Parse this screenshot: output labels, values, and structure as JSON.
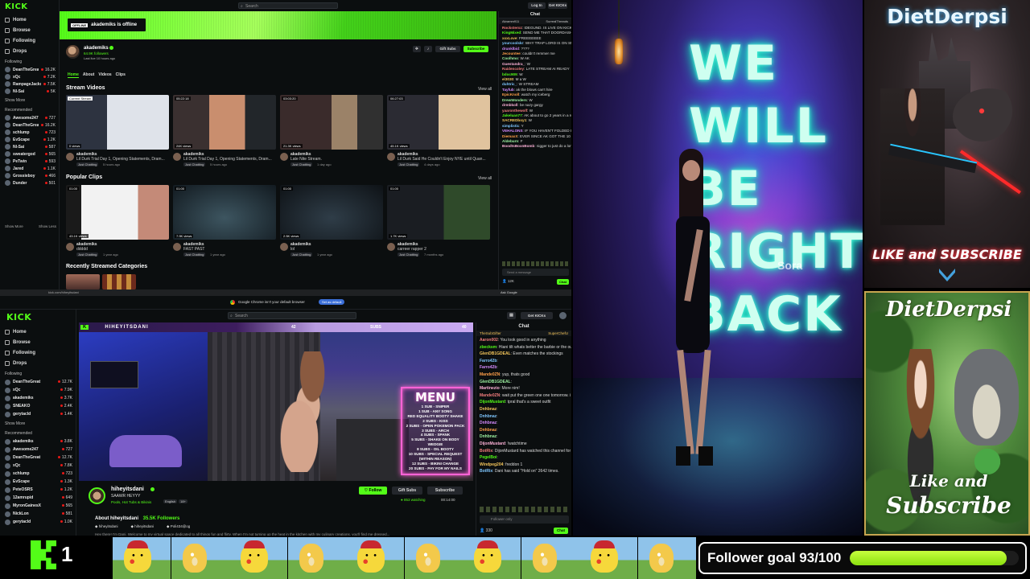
{
  "top": {
    "logo": "KICK",
    "search_placeholder": "Search",
    "login_label": "Log In",
    "signup_label": "Get KICKs",
    "nav": [
      "Home",
      "Browse",
      "Following",
      "Drops"
    ],
    "following_header": "Following",
    "show_more": "Show More",
    "show_less": "Show Less",
    "recommended_header": "Recommended",
    "following": [
      {
        "name": "DeanTheGreat",
        "sub": "IRL",
        "viewers": "16.2K"
      },
      {
        "name": "xQc",
        "sub": "Jackbox Party Packs",
        "viewers": "7.2K"
      },
      {
        "name": "RampageJackson",
        "sub": "PUBG: Battlegrounds",
        "viewers": "7.5K"
      },
      {
        "name": "Nl-Sai",
        "sub": "Just Chatting",
        "viewers": "5K"
      }
    ],
    "recommended": [
      {
        "name": "Awesome247",
        "sub": "World of Warcraft",
        "viewers": "727"
      },
      {
        "name": "DeanTheGreat",
        "sub": "IRL",
        "viewers": "16.2K"
      },
      {
        "name": "schlump",
        "sub": "Slots & Casino",
        "viewers": "723"
      },
      {
        "name": "EvScape",
        "sub": "Old School RuneScape",
        "viewers": "1.2K"
      },
      {
        "name": "Nl-Sai",
        "sub": "Just Chatting",
        "viewers": "587"
      },
      {
        "name": "sweatergod",
        "sub": "Just Chatting",
        "viewers": "565"
      },
      {
        "name": "PeTwin",
        "sub": "Slots & Casino",
        "viewers": "593"
      },
      {
        "name": "Jared",
        "sub": "Slots & Casino",
        "viewers": "1.1K"
      },
      {
        "name": "Grossieboy",
        "sub": "Slots & Casino",
        "viewers": "466"
      },
      {
        "name": "Dunder",
        "sub": "Old School RuneScape",
        "viewers": "501"
      }
    ],
    "banner_tag": "OFFLINE",
    "banner_text": "akademiks is offline",
    "channel_name": "akademiks",
    "followers": "64.9K followers",
    "last_live": "Last live 10 hours ago",
    "gift_subs": "Gift Subs",
    "subscribe": "Subscribe",
    "tabs": [
      "Home",
      "About",
      "Videos",
      "Clips"
    ],
    "stream_videos_title": "Stream Videos",
    "popular_clips_title": "Popular Clips",
    "categories_title": "Recently Streamed Categories",
    "view_all": "View all",
    "videos": [
      {
        "badge": "Current Stream",
        "duration": "",
        "views": "0 views",
        "title": "Lil Durk Trial Day 1, Opening Statements, Dram...",
        "meta": "5 hours ago",
        "tag": "Just Chatting"
      },
      {
        "badge": "",
        "duration": "05:22:18",
        "views": "24K views",
        "title": "Lil Durk Trial Day 1, Opening Statements, Dram...",
        "meta": "5 hours ago",
        "tag": "Just Chatting"
      },
      {
        "badge": "",
        "duration": "03:03:20",
        "views": "21.3K views",
        "title": "Late Nite Stream.",
        "meta": "1 day ago",
        "tag": "Just Chatting"
      },
      {
        "badge": "",
        "duration": "06:27:03",
        "views": "45.1K views",
        "title": "Lil Durk Said He Couldn't Enjoy NYE until Quan...",
        "meta": "4 days ago",
        "tag": "Just Chatting"
      }
    ],
    "clips": [
      {
        "duration": "01:00",
        "views": "43.1K views",
        "title": "ddddd",
        "meta": "1 year ago",
        "tag": "Just Chatting"
      },
      {
        "duration": "01:00",
        "views": "7.9K views",
        "title": "FAST PAST",
        "meta": "1 year ago",
        "tag": "Just Chatting"
      },
      {
        "duration": "01:00",
        "views": "2.5K views",
        "title": "lol",
        "meta": "1 year ago",
        "tag": "Just Chatting"
      },
      {
        "duration": "01:00",
        "views": "1.7K views",
        "title": "carreer rapper 2",
        "meta": "7 months ago",
        "tag": "Just Chatting"
      }
    ],
    "chat_title": "Chat",
    "chat_banner_1": "Akramm911",
    "chat_banner_2": "SurrealThreads",
    "chat": [
      "Rocksteroz: IDEGUND. IS LIVE ON KICK TKP!!",
      "KingMixed: SEND ME THAT DOORDASH ACCOUNT",
      "xxxLove: FREEEEEEE",
      "yourcoolskr: WHY TRAP LORD IS ON SMURFS??",
      "drunklbid: ????",
      "Jecountee: couldn't remmer me",
      "Coolhmo: W AK",
      "Guestandra_: W",
      "Raidencoley: LATE STREAM AI READY",
      "bdoc909: W",
      "el3030: M a W",
      "duhtric_: W STREAM",
      "Tayfub: ak the blows can't hire",
      "EpicKnoll: watch my iceberg",
      "DrewWonders: W",
      "drmbkoll: be nazy gargy",
      "yaaronthewolf: W",
      "Jakeluan77: AK about to go 2 years in a row of a few rounds",
      "SACREDboy1: W",
      "simplistic: Y",
      "VEHALONS: IF YOU HAVEN'T FOLDED IT OUT YET - HE'S A LIBERAL SHILL",
      "DiemaxX: EVER SINCE AK GOT THE 10 MONTHLY ALLOWANCE HE'S BEEN A JOY",
      "Aldeburn: F",
      "BoodtsBoxnBomb: nigger to just do a long ass stream ahahaha"
    ],
    "chat_input_placeholder": "Send a message",
    "chat_send": "Chat",
    "chat_counter": "12K"
  },
  "bottom": {
    "logo": "KICK",
    "url": "kick.com/hiheyitsdani",
    "chrome_notice": "Google Chrome isn't your default browser",
    "chrome_button": "Set as default",
    "ask_google": "Ask Google",
    "search_placeholder": "Search",
    "signup_label": "Get KICKs",
    "nav": [
      "Home",
      "Browse",
      "Following",
      "Drops"
    ],
    "following_header": "Following",
    "show_more": "Show More",
    "recommended_header": "Recommended",
    "following": [
      {
        "name": "DeanTheGreat",
        "sub": "IRL",
        "viewers": "12.7K"
      },
      {
        "name": "xQc",
        "sub": "Jackbox Party Packs",
        "viewers": "7.9K"
      },
      {
        "name": "akademiks",
        "sub": "Just Chatting",
        "viewers": "3.7K"
      },
      {
        "name": "SNEAKO",
        "sub": "Slots & Casino",
        "viewers": "2.4K"
      },
      {
        "name": "gerytacld",
        "sub": "IRL",
        "viewers": "1.4K"
      }
    ],
    "recommended": [
      {
        "name": "akademiks",
        "sub": "Just Chatting",
        "viewers": "3.8K"
      },
      {
        "name": "Awesome247",
        "sub": "World of Warcraft",
        "viewers": "727"
      },
      {
        "name": "DeanTheGreat",
        "sub": "IRL",
        "viewers": "12.7K"
      },
      {
        "name": "xQc",
        "sub": "Jackbox Party Packs",
        "viewers": "7.8K"
      },
      {
        "name": "schlump",
        "sub": "Slots & Casino",
        "viewers": "723"
      },
      {
        "name": "EvScape",
        "sub": "Old School RuneScape",
        "viewers": "1.3K"
      },
      {
        "name": "PeteOSRS",
        "sub": "Old School RuneScape",
        "viewers": "1.2K"
      },
      {
        "name": "12amrupid",
        "sub": "Just Chatting",
        "viewers": "649"
      },
      {
        "name": "MyronGainesX",
        "sub": "Just Chatting",
        "viewers": "565"
      },
      {
        "name": "NickLon",
        "sub": "Just Chatting",
        "viewers": "581"
      },
      {
        "name": "gerytacld",
        "sub": "IRL",
        "viewers": "1.0K"
      }
    ],
    "overlay_handle": "HIHEYITSDANI",
    "overlay_count_left": "42",
    "overlay_subs": "SUBS",
    "overlay_count_right": "40",
    "menu_title": "MENU",
    "menu_items": [
      "1 SUB - SNIPER",
      "1 SUB - ANY SONG",
      "RED EQUALITY BOOTY SHAKE",
      "2 SUBS - KISS",
      "2 SUBS - OPEN POKEMON PACK",
      "3 SUBS - ARCH",
      "4 SUBS - SPANK",
      "5 SUBS - SHAKE ON BODY",
      "WEDGIE",
      "8 SUBS - OIL BOOTY",
      "10 SUBS - SPECIAL REQUEST",
      "(WITHIN REASON)",
      "12 SUBS - BIKINI CHANGE",
      "20 SUBS - PAY FOR MY NAILS"
    ],
    "streamer": "hiheyitsdani",
    "stream_title": "SAAWR HEYYY",
    "categories": "Pools, Hot Tubs & Bikinis",
    "lang": "English",
    "age": "18+",
    "follow": "Follow",
    "gift_subs": "Gift Subs",
    "subscribe": "Subscribe",
    "watching": "853 watching",
    "uptime": "00:14:00",
    "about_title": "About hiheyitsdani",
    "about_followers": "35.5K Followers",
    "socials": [
      "hiheyitsdani",
      "hiheyitsdani",
      "Poli434@og"
    ],
    "about_text": "Hey there! I'm Dani. Welcome to my virtual space dedicated to all things fun and flirty. When I'm not turning up the heat in the kitchen with my culinary creations, you'll find me dressed...",
    "chat_title": "Chat",
    "chat_banner_1": "TheSubGifter",
    "chat_banner_2": "SuperChefU",
    "chat": [
      "Aaron002: You look good in anything",
      "zbecksm: Hiani tilt whats better the barbie or the outfit",
      "GlenDB1GDEAL: Even matches the stockings",
      "Farro42b:",
      "Farro42b:",
      "Mande0ZN: yup, thats good",
      "GlenDB1GDEAL:",
      "Martinezio: More nim!",
      "Mande0ZN: wait put the green one one tomorrow. i wanna see it longer",
      "DijonMustard: tpral that's a sweet outfit",
      "Dnhbnaz:",
      "Dnhbnaz:",
      "Dnhbnaz:",
      "Dnhbnaz:",
      "Dnhbnaz:",
      "DijonMustard: !watchtime",
      "BotRix: DijonMustard has watched this channel for 1 months 4 days 11 hours.",
      "PegelBoi:",
      "Windpeg204: freddon 1",
      "BotRix: Dani has said \"Hold on\" 2642 times."
    ],
    "chat_input_placeholder": "Follower only",
    "chat_send": "Chat",
    "chat_counter": "330"
  },
  "neon": {
    "lines": [
      "WE",
      "WILL",
      "BE",
      "RIGHT",
      "BACK"
    ],
    "watermark": "Sora"
  },
  "side_panels": {
    "top_title": "DietDerpsi",
    "top_cta": "LIKE and SUBSCRIBE",
    "bottom_title": "DietDerpsi",
    "bottom_cta_1": "Like and",
    "bottom_cta_2": "Subscribe"
  },
  "footer": {
    "kick_count": "1",
    "follower_goal_label": "Follower goal 93/100",
    "follower_goal_progress": 0.93
  },
  "colors": {
    "kick_green": "#53fc18",
    "dark_bg": "#0b0e0f",
    "neon": "#59ffe0",
    "panel_red": "#e8313d"
  }
}
